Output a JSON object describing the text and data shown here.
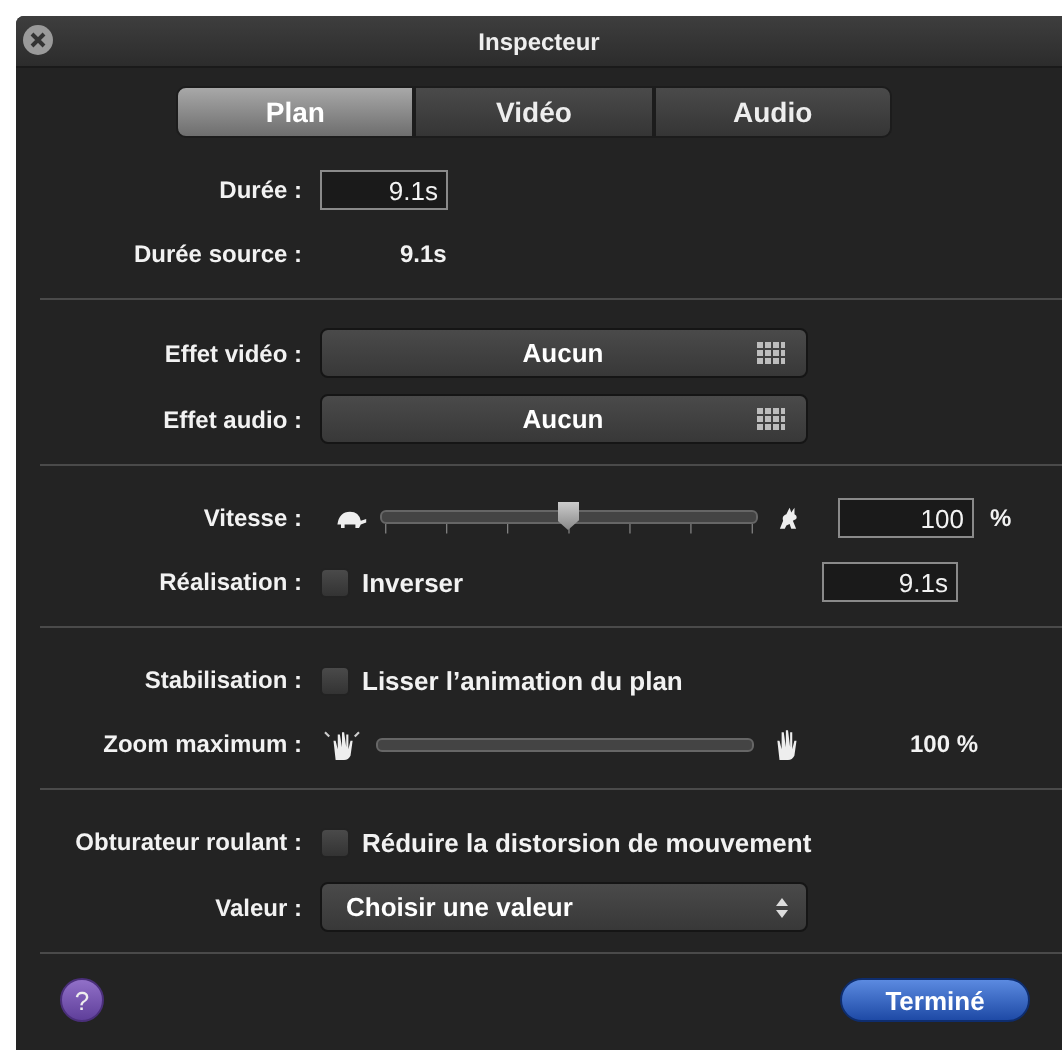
{
  "window": {
    "title": "Inspecteur"
  },
  "tabs": [
    {
      "label": "Plan",
      "selected": true
    },
    {
      "label": "Vidéo",
      "selected": false
    },
    {
      "label": "Audio",
      "selected": false
    }
  ],
  "sections": [
    {
      "rows": [
        {
          "kind": "field",
          "label": "Durée :",
          "value": "9.1s"
        },
        {
          "kind": "text",
          "label": "Durée source :",
          "value": "9.1s"
        }
      ]
    },
    {
      "rows": [
        {
          "kind": "effect",
          "label": "Effet vidéo :",
          "value": "Aucun"
        },
        {
          "kind": "effect",
          "label": "Effet audio :",
          "value": "Aucun"
        }
      ]
    },
    {
      "rows": [
        {
          "kind": "speed",
          "label": "Vitesse :",
          "level": 0.5,
          "value": "100",
          "unit": "%"
        },
        {
          "kind": "checkbox-field",
          "label": "Réalisation :",
          "option": "Inverser",
          "checked": false,
          "value": "9.1s"
        }
      ]
    },
    {
      "rows": [
        {
          "kind": "checkbox",
          "label": "Stabilisation :",
          "option": "Lisser l’animation du plan",
          "checked": false
        },
        {
          "kind": "zoom",
          "label": "Zoom maximum :",
          "value": "100 %"
        }
      ]
    },
    {
      "rows": [
        {
          "kind": "checkbox",
          "label": "Obturateur roulant :",
          "option": "Réduire la distorsion de mouvement",
          "checked": false
        },
        {
          "kind": "select",
          "label": "Valeur :",
          "value": "Choisir une valeur"
        }
      ]
    }
  ],
  "help": "?",
  "done_button": "Terminé"
}
